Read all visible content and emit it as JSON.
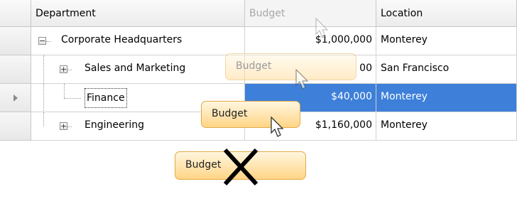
{
  "columns": {
    "department": "Department",
    "budget": "Budget",
    "location": "Location"
  },
  "rows": [
    {
      "department": "Corporate Headquarters",
      "budget": "$1,000,000",
      "location": "Monterey",
      "expander": "−"
    },
    {
      "department": "Sales and Marketing",
      "budget": "00",
      "location": "San Francisco",
      "expander": "+"
    },
    {
      "department": "Finance",
      "budget": "$40,000",
      "location": "Monterey",
      "expander": ""
    },
    {
      "department": "Engineering",
      "budget": "$1,160,000",
      "location": "Monterey",
      "expander": "+"
    }
  ],
  "drag_tokens": {
    "ghost": "Budget",
    "active": "Budget",
    "drop": "Budget"
  },
  "icons": {
    "row_indicator": "triangle-right-icon",
    "cursor": "arrow-cursor-icon",
    "forbidden": "x-icon"
  },
  "colors": {
    "selection": "#3d7fd9",
    "token_top": "#fff6df",
    "token_bottom": "#ffd586",
    "token_border": "#e3a945"
  }
}
